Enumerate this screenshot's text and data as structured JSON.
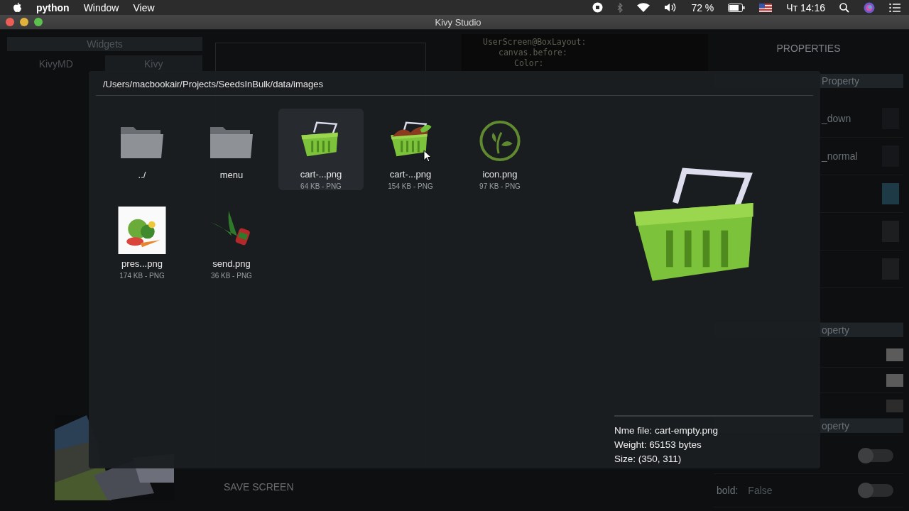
{
  "menubar": {
    "app": "python",
    "menus": [
      "Window",
      "View"
    ],
    "battery": "72 %",
    "clock": "Чт 14:16"
  },
  "window": {
    "title": "Kivy Studio"
  },
  "widgets_panel": {
    "title": "Widgets",
    "tabs": [
      {
        "label": "KivyMD",
        "selected": false
      },
      {
        "label": "Kivy",
        "selected": true
      }
    ]
  },
  "canvas": {
    "save_button": "SAVE SCREEN"
  },
  "code_editor": {
    "lines": [
      "UserScreen@BoxLayout:",
      "canvas.before:",
      "Color:"
    ]
  },
  "properties": {
    "title": "PROPERTIES",
    "rows": [
      {
        "kind": "header",
        "label": "Property"
      },
      {
        "kind": "swatch",
        "label": "_down",
        "color": "#15171a"
      },
      {
        "kind": "swatch",
        "label": "_normal",
        "color": "#15171a"
      },
      {
        "kind": "swatch",
        "color": "#1e3a46"
      },
      {
        "kind": "swatch",
        "color": "#1d1e20"
      },
      {
        "kind": "swatch",
        "color": "#1d1e20"
      },
      {
        "kind": "blank"
      },
      {
        "kind": "header",
        "label": "operty"
      },
      {
        "kind": "swatch",
        "color": "#5b5b5b"
      },
      {
        "kind": "swatch",
        "color": "#5b5b5b"
      },
      {
        "kind": "swatch",
        "color": "#2c2c2c"
      },
      {
        "kind": "header",
        "label": "operty"
      },
      {
        "kind": "toggle",
        "on": false
      },
      {
        "kind": "toggle",
        "label": "bold:",
        "value": "False",
        "on": false
      }
    ]
  },
  "file_dialog": {
    "path": "/Users/macbookair/Projects/SeedsInBulk/data/images",
    "items": [
      {
        "kind": "folder",
        "name": "../",
        "selected": false
      },
      {
        "kind": "folder",
        "name": "menu",
        "selected": false
      },
      {
        "kind": "basket",
        "name": "cart-...png",
        "meta": "64 KB - PNG",
        "selected": true
      },
      {
        "kind": "full-basket",
        "name": "cart-...png",
        "meta": "154 KB - PNG",
        "selected": false
      },
      {
        "kind": "logo",
        "name": "icon.png",
        "meta": "97 KB - PNG",
        "selected": false
      },
      {
        "kind": "picture",
        "name": "pres...png",
        "meta": "174 KB - PNG",
        "selected": false
      },
      {
        "kind": "sprout",
        "name": "send.png",
        "meta": "36 KB - PNG",
        "selected": false
      }
    ],
    "info": [
      "Nme file: cart-empty.png",
      "Weight: 65153 bytes",
      "Size: (350, 311)"
    ]
  }
}
